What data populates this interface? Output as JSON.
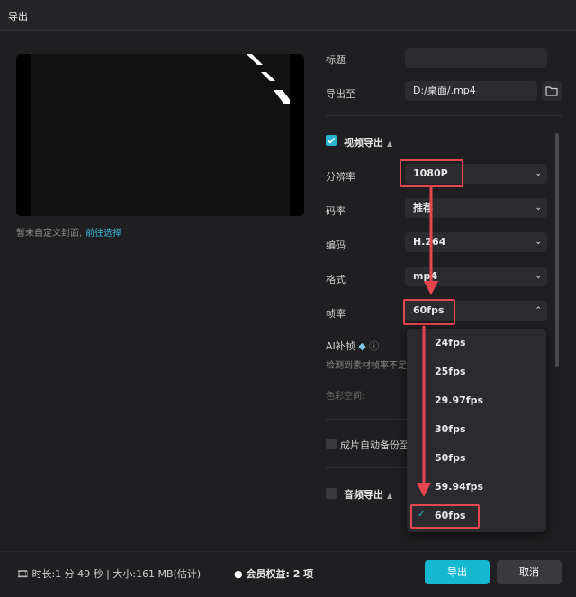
{
  "title": "导出",
  "cover": {
    "hint": "暂未自定义封面,",
    "link": "前往选择"
  },
  "fields": {
    "title_label": "标题",
    "title_value": "",
    "export_to_label": "导出至",
    "export_to_value": "D:/桌面/.mp4"
  },
  "video": {
    "section_label": "视频导出",
    "resolution_label": "分辨率",
    "resolution_value": "1080P",
    "bitrate_label": "码率",
    "bitrate_value": "推荐",
    "codec_label": "编码",
    "codec_value": "H.264",
    "format_label": "格式",
    "format_value": "mp4",
    "framerate_label": "帧率",
    "framerate_value": "60fps",
    "ai_label": "AI补帧",
    "ai_desc": "检测到素材帧率不足",
    "colorspace_label": "色彩空间:"
  },
  "backup_label": "成片自动备份至",
  "audio_label": "音频导出",
  "dropdown": {
    "options": [
      "24fps",
      "25fps",
      "29.97fps",
      "30fps",
      "50fps",
      "59.94fps",
      "60fps"
    ],
    "selected": "60fps"
  },
  "footer": {
    "info": "时长:1 分 49 秒 | 大小:161 MB(估计)",
    "member_label": "会员权益:",
    "member_count": "2 项"
  },
  "buttons": {
    "export": "导出",
    "cancel": "取消"
  },
  "colors": {
    "accent": "#14b8d0",
    "highlight": "#e8464f",
    "background": "#1f1f21"
  }
}
